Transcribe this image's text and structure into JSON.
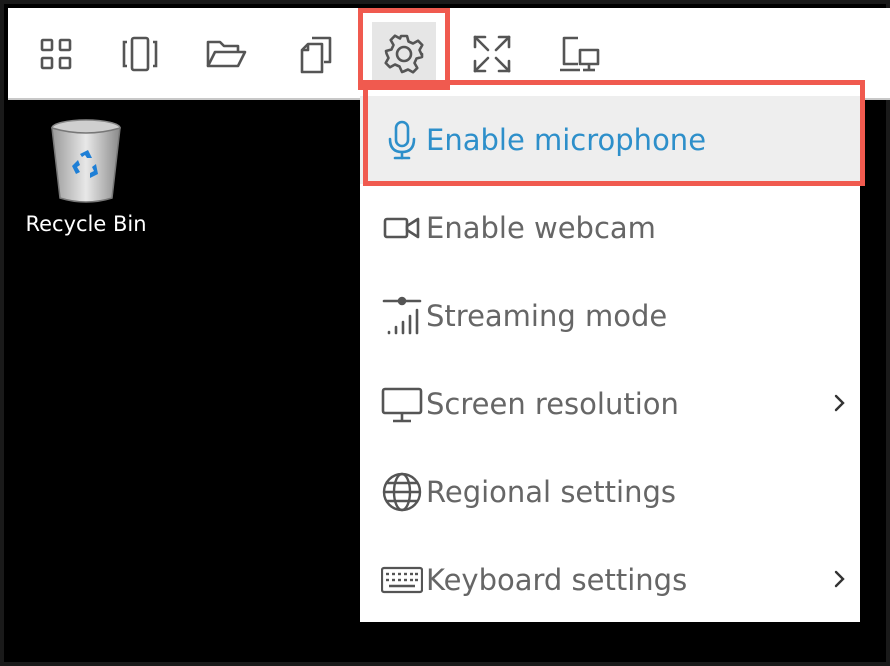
{
  "toolbar": {
    "buttons": [
      {
        "icon": "grid-icon"
      },
      {
        "icon": "carousel-icon"
      },
      {
        "icon": "folder-open-icon"
      },
      {
        "icon": "copy-icon"
      },
      {
        "icon": "gear-icon",
        "selected": true
      },
      {
        "icon": "fullscreen-icon"
      },
      {
        "icon": "dual-monitor-icon"
      }
    ]
  },
  "desktop": {
    "recycle_bin_label": "Recycle Bin"
  },
  "settings_menu": {
    "items": [
      {
        "label": "Enable microphone",
        "icon": "microphone-icon",
        "active": true
      },
      {
        "label": "Enable webcam",
        "icon": "webcam-icon"
      },
      {
        "label": "Streaming mode",
        "icon": "streaming-signal-icon"
      },
      {
        "label": "Screen resolution",
        "icon": "monitor-icon",
        "submenu": true
      },
      {
        "label": "Regional settings",
        "icon": "globe-icon"
      },
      {
        "label": "Keyboard settings",
        "icon": "keyboard-icon",
        "submenu": true
      }
    ]
  },
  "colors": {
    "accent": "#2d8fca",
    "highlight": "#f05a4f",
    "menu_text": "#666666",
    "active_bg": "#eeeeee"
  }
}
